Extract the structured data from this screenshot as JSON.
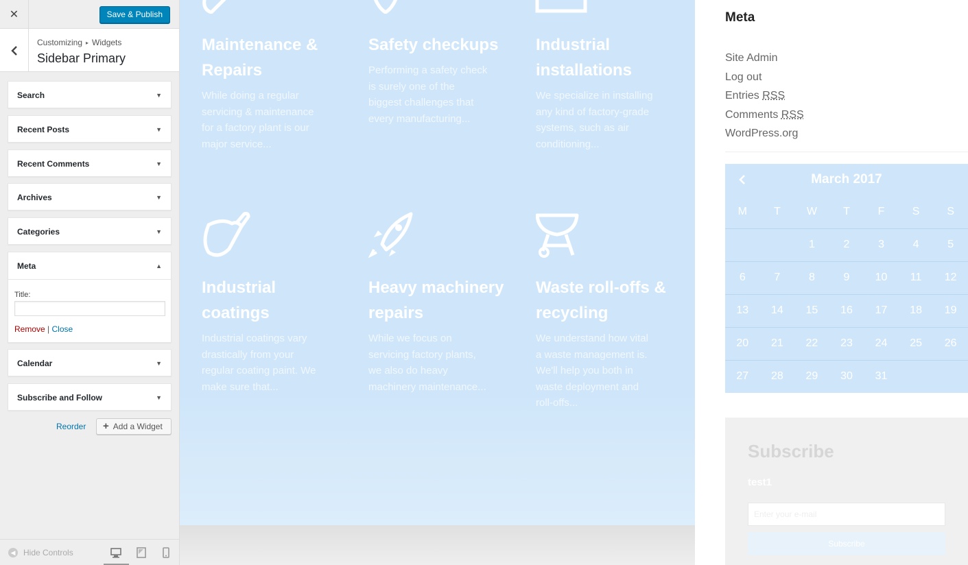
{
  "customizer": {
    "close_icon": "close-icon",
    "publish_label": "Save & Publish",
    "breadcrumb": [
      "Customizing",
      "Widgets"
    ],
    "section_title": "Sidebar Primary",
    "widgets": [
      {
        "label": "Search"
      },
      {
        "label": "Recent Posts"
      },
      {
        "label": "Recent Comments"
      },
      {
        "label": "Archives"
      },
      {
        "label": "Categories"
      },
      {
        "label": "Meta",
        "open": true
      },
      {
        "label": "Calendar"
      },
      {
        "label": "Subscribe and Follow"
      }
    ],
    "meta_form": {
      "title_label": "Title:",
      "title_value": "",
      "remove_label": "Remove",
      "separator": "|",
      "close_label": "Close"
    },
    "reorder_label": "Reorder",
    "add_widget_label": "Add a Widget",
    "hide_controls_label": "Hide Controls"
  },
  "preview": {
    "services": [
      {
        "title": "Maintenance & Repairs",
        "desc": "While doing a regular servicing & maintenance for a factory plant is our major service..."
      },
      {
        "title": "Safety checkups",
        "desc": "Performing a safety check is surely one of the biggest challenges that every manufacturing..."
      },
      {
        "title": "Industrial installations",
        "desc": "We specialize in installing any kind of factory-grade systems, such as air conditioning..."
      },
      {
        "title": "Industrial coatings",
        "desc": "Industrial coatings vary drastically from your regular coating paint. We make sure that..."
      },
      {
        "title": "Heavy machinery repairs",
        "desc": "While we focus on servicing factory plants, we also do heavy machinery maintenance..."
      },
      {
        "title": "Waste roll-offs & recycling",
        "desc": "We understand how vital a waste management is. We'll help you both in waste deployment and roll-offs..."
      }
    ],
    "sidebar": {
      "meta_heading": "Meta",
      "meta_links": [
        "Site Admin",
        "Log out",
        "Entries RSS",
        "Comments RSS",
        "WordPress.org"
      ],
      "calendar": {
        "caption": "March 2017",
        "weekdays": [
          "M",
          "T",
          "W",
          "T",
          "F",
          "S",
          "S"
        ],
        "weeks": [
          [
            "",
            "",
            "1",
            "2",
            "3",
            "4",
            "5"
          ],
          [
            "6",
            "7",
            "8",
            "9",
            "10",
            "11",
            "12"
          ],
          [
            "13",
            "14",
            "15",
            "16",
            "17",
            "18",
            "19"
          ],
          [
            "20",
            "21",
            "22",
            "23",
            "24",
            "25",
            "26"
          ],
          [
            "27",
            "28",
            "29",
            "30",
            "31",
            "",
            ""
          ]
        ]
      },
      "subscribe": {
        "title": "Subscribe",
        "text": "test1",
        "placeholder": "Enter your e-mail",
        "button_label": "Subscribe"
      }
    }
  }
}
